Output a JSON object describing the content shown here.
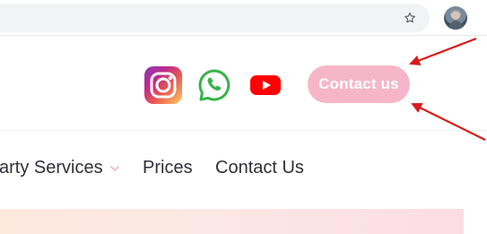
{
  "browser": {
    "bookmark_icon": "☆",
    "profile_icon": "avatar"
  },
  "header": {
    "social_icons": [
      "instagram-icon",
      "whatsapp-icon",
      "youtube-icon"
    ],
    "contact_button_label": "Contact us",
    "contact_button_color": "#f6b6c9",
    "annotation_arrow_color": "#d91b1b"
  },
  "nav": {
    "services_label": "arty Services",
    "services_chevron_icon": "chevron-down-icon",
    "prices_label": "Prices",
    "contact_label": "Contact Us"
  },
  "hero": {
    "gradient_colors": [
      "#fde8de",
      "#fbdde5"
    ]
  }
}
